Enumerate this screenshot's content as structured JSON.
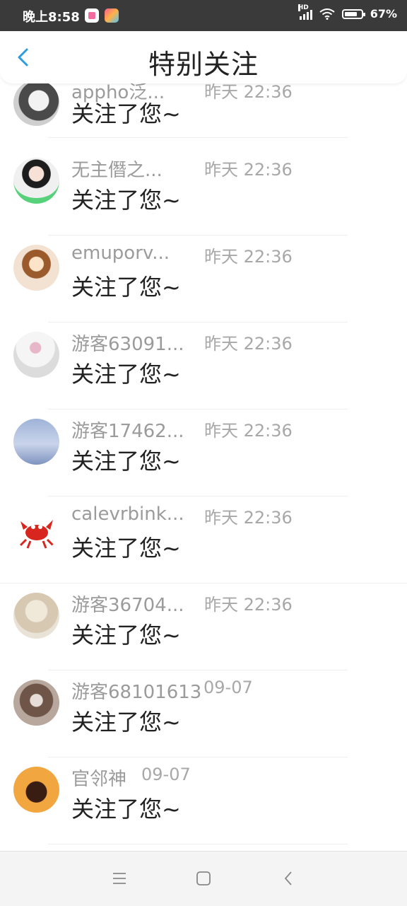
{
  "status_bar": {
    "time": "晚上8:58",
    "network": "HD",
    "battery": "67%"
  },
  "header": {
    "title": "特别关注",
    "back_icon": "chevron-left-icon",
    "accent": "#2b9de0"
  },
  "items": [
    {
      "name": "appho泛...",
      "time": "昨天 22:36",
      "message": "关注了您~"
    },
    {
      "name": "无主僭之...",
      "time": "昨天 22:36",
      "message": "关注了您~"
    },
    {
      "name": "emuporv...",
      "time": "昨天 22:36",
      "message": "关注了您~"
    },
    {
      "name": "游客63091...",
      "time": "昨天 22:36",
      "message": "关注了您~"
    },
    {
      "name": "游客17462...",
      "time": "昨天 22:36",
      "message": "关注了您~"
    },
    {
      "name": "calevrbink...",
      "time": "昨天 22:36",
      "message": "关注了您~"
    },
    {
      "name": "游客36704...",
      "time": "昨天 22:36",
      "message": "关注了您~"
    },
    {
      "name": "游客68101613",
      "time": "09-07",
      "message": "关注了您~"
    },
    {
      "name": "官邻神",
      "time": "09-07",
      "message": "关注了您~"
    }
  ],
  "nav_bar": {
    "menu_icon": "menu-icon",
    "home_icon": "home-square-icon",
    "back_icon": "back-chevron-icon"
  }
}
